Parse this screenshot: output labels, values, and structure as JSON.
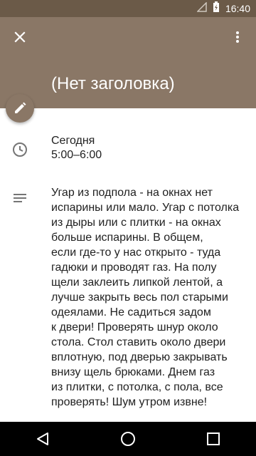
{
  "status_bar": {
    "time": "16:40"
  },
  "header": {
    "title": "(Нет заголовка)"
  },
  "event": {
    "day": "Сегодня",
    "time_range": "5:00–6:00",
    "description": "Угар из подпола - на окнах нет\nиспарины или мало. Угар с потолка\nиз дыры или с плитки - на окнах\nбольше испарины. В общем,\nесли где-то у нас открыто - туда\nгадюки и проводят газ. На полу\nщели заклеить липкой лентой, а\nлучше закрыть весь пол старыми\nодеялами. Не садиться задом\nк двери! Проверять шнур около\nстола. Стол ставить около двери\nвплотную, под дверью закрывать\nвнизу щель брюками. Днем газ\nиз плитки, с потолка, с пола, все\nпроверять! Шум утром извне!"
  },
  "colors": {
    "header": "#8a7766",
    "status_bar": "#6b5a48",
    "icon_gray": "#757575"
  },
  "icons": [
    "close-icon",
    "more-vert-icon",
    "edit-icon",
    "clock-icon",
    "notes-icon",
    "back-icon",
    "home-icon",
    "recents-icon"
  ]
}
